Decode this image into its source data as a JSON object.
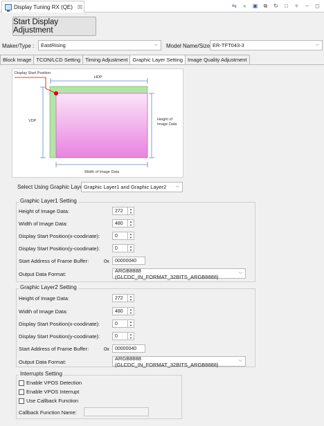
{
  "view": {
    "tab_title": "Display Tuning RX (QE)",
    "close_glyph": "☒",
    "toolbar_icons": [
      "sync-icon",
      "rewind-icon",
      "save-icon",
      "copy-icon",
      "redo-icon",
      "square-icon",
      "view-menu-icon",
      "minimize-icon",
      "maximize-icon"
    ]
  },
  "start_button": "Start Display Adjustment",
  "maker": {
    "label": "Maker/Type :",
    "value": "EastRising"
  },
  "model": {
    "label": "Model Name/Size :",
    "value": "ER-TFT043-3"
  },
  "tabs": [
    "Block Image",
    "TCON/LCD Setting",
    "Timing Adjustment",
    "Graphic Layer Setting",
    "Image Quality Adjustment"
  ],
  "active_tab": 3,
  "diagram": {
    "display_start_position": "Display Start Position",
    "hdp": "HDP",
    "vdp": "VDP",
    "height_of_image_data": "Height of Image Data",
    "width_of_image_data": "Width of Image Data",
    "colors": {
      "layer1": "#b6e3a8",
      "layer2": "#ef9be8",
      "marker": "#d80000",
      "line": "#5a8ac6"
    }
  },
  "select_layer": {
    "label": "Select Using Graphic Layer:",
    "value": "Graphic Layer1 and Graphic Layer2"
  },
  "layer1": {
    "title": "Graphic Layer1 Setting",
    "height_label": "Height of Image Data:",
    "height_value": "272",
    "width_label": "Width of Image Data:",
    "width_value": "480",
    "x_label": "Display Start Position(x-coodinate):",
    "x_value": "0",
    "y_label": "Display Start Position(y-coodinate):",
    "y_value": "0",
    "addr_label": "Start Address of Frame Buffer:",
    "addr_prefix": "0x",
    "addr_value": "00000040",
    "format_label": "Output Data Format:",
    "format_value": "ARGB8888 (GLCDC_IN_FORMAT_32BITS_ARGB8888)"
  },
  "layer2": {
    "title": "Graphic Layer2 Setting",
    "height_label": "Height of Image Data:",
    "height_value": "272",
    "width_label": "Width of Image Data:",
    "width_value": "480",
    "x_label": "Display Start Position(x-coodinate):",
    "x_value": "0",
    "y_label": "Display Start Position(y-coodinate):",
    "y_value": "0",
    "addr_label": "Start Address of Frame Buffer:",
    "addr_prefix": "0x",
    "addr_value": "00000040",
    "format_label": "Output Data Format:",
    "format_value": "ARGB8888 (GLCDC_IN_FORMAT_32BITS_ARGB8888)"
  },
  "interrupts": {
    "title": "Interrupts Setting",
    "vpos_detection": "Enable VPOS Detection",
    "vpos_interrupt": "Enable VPOS Interrupt",
    "callback": "Use Callback Function",
    "callback_name_label": "Callback Function Name:",
    "callback_name_value": ""
  }
}
